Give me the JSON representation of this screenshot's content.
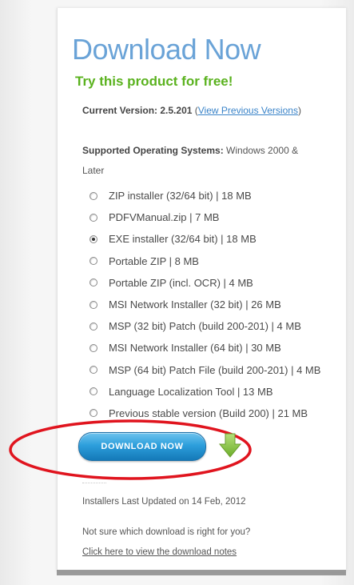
{
  "title": "Download Now",
  "subtitle": "Try this product for free!",
  "version": {
    "label": "Current Version:",
    "value": "2.5.201",
    "paren_open": " (",
    "link": "View Previous Versions",
    "paren_close": ")"
  },
  "os": {
    "label": "Supported Operating Systems:",
    "value": "Windows 2000 & Later"
  },
  "options": [
    {
      "label": "ZIP installer (32/64 bit) | 18 MB",
      "checked": false
    },
    {
      "label": "PDFVManual.zip | 7 MB",
      "checked": false
    },
    {
      "label": "EXE installer (32/64 bit) | 18 MB",
      "checked": true
    },
    {
      "label": "Portable ZIP | 8 MB",
      "checked": false
    },
    {
      "label": "Portable ZIP (incl. OCR) | 4 MB",
      "checked": false
    },
    {
      "label": "MSI Network Installer (32 bit) | 26 MB",
      "checked": false
    },
    {
      "label": "MSP (32 bit) Patch (build 200-201) | 4 MB",
      "checked": false
    },
    {
      "label": "MSI Network Installer (64 bit) | 30 MB",
      "checked": false
    },
    {
      "label": "MSP (64 bit) Patch File (build 200-201) | 4 MB",
      "checked": false
    },
    {
      "label": "Language Localization Tool | 13 MB",
      "checked": false
    },
    {
      "label": "Previous stable version (Build 200) | 21 MB",
      "checked": false
    }
  ],
  "download_button": "DOWNLOAD NOW",
  "updated_text": "Installers Last Updated on 14 Feb, 2012",
  "not_sure_text": "Not sure which download is right for you?",
  "notes_link": "Click here to view the download notes",
  "colors": {
    "title": "#6aa3d7",
    "subtitle": "#5ab21e",
    "link": "#3a84c9",
    "button": "#2d9fdc",
    "arrow": "#8cc63f",
    "highlight": "#e0141e"
  },
  "icons": {
    "download_arrow": "green-down-arrow-icon"
  }
}
